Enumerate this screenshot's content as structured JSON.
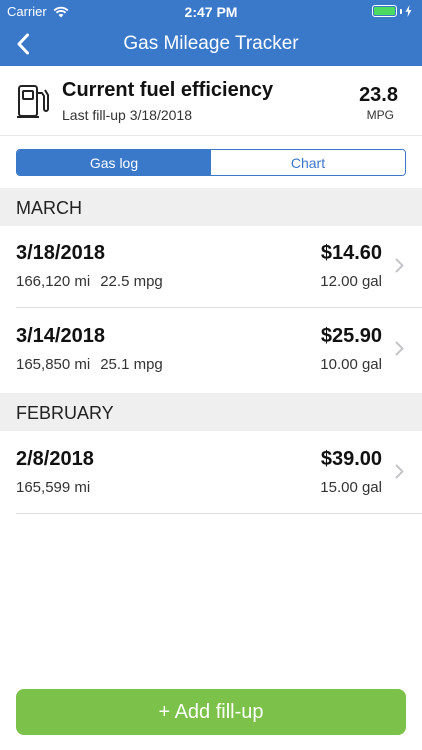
{
  "status": {
    "carrier": "Carrier",
    "time": "2:47 PM"
  },
  "nav": {
    "title": "Gas Mileage Tracker"
  },
  "summary": {
    "title": "Current fuel efficiency",
    "subtitle": "Last fill-up 3/18/2018",
    "value": "23.8",
    "unit": "MPG"
  },
  "segment": {
    "gas_log": "Gas log",
    "chart": "Chart",
    "selected": "Gas log"
  },
  "sections": [
    {
      "label": "MARCH",
      "entries": [
        {
          "date": "3/18/2018",
          "miles": "166,120 mi",
          "mpg": "22.5 mpg",
          "price": "$14.60",
          "gallons": "12.00 gal"
        },
        {
          "date": "3/14/2018",
          "miles": "165,850 mi",
          "mpg": "25.1 mpg",
          "price": "$25.90",
          "gallons": "10.00 gal"
        }
      ]
    },
    {
      "label": "FEBRUARY",
      "entries": [
        {
          "date": "2/8/2018",
          "miles": "165,599 mi",
          "mpg": "",
          "price": "$39.00",
          "gallons": "15.00 gal"
        }
      ]
    }
  ],
  "add_button": {
    "label": "+ Add fill-up"
  },
  "colors": {
    "primary": "#3a78c9",
    "accent_green": "#7bc14a",
    "battery_green": "#4cd964",
    "section_bg": "#efefef"
  }
}
